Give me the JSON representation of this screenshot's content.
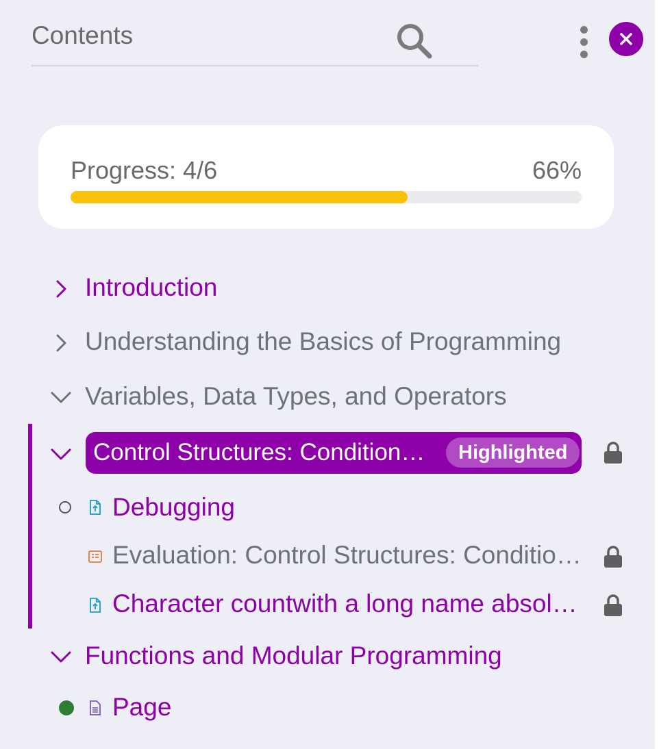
{
  "header": {
    "title": "Contents",
    "icons": [
      "search-icon",
      "more-vertical-icon",
      "close-icon"
    ]
  },
  "progress": {
    "label": "Progress: 4/6",
    "percent_text": "66%",
    "fraction": 0.66
  },
  "outline": {
    "intro": {
      "label": "Introduction",
      "state": "collapsed"
    },
    "basics": {
      "label": "Understanding the Basics of Programming",
      "state": "collapsed"
    },
    "variables": {
      "label": "Variables, Data Types, and Operators",
      "state": "expanded"
    },
    "control": {
      "label": "Control Structures: Conditionals and Loops",
      "badge": "Highlighted",
      "state": "expanded",
      "locked": true
    },
    "control_items": [
      {
        "label": "Debugging",
        "icon": "upload-file-icon",
        "status": "not-started"
      },
      {
        "label": "Evaluation: Control Structures: Conditionals and Loops",
        "icon": "quiz-icon",
        "locked": true
      },
      {
        "label": "Character countwith a long name absolutely",
        "icon": "upload-file-icon",
        "locked": true
      }
    ],
    "functions": {
      "label": "Functions and Modular Programming",
      "state": "expanded"
    },
    "functions_items": [
      {
        "label": "Page",
        "icon": "page-icon",
        "status": "completed"
      }
    ]
  },
  "colors": {
    "accent": "#8e00a8",
    "progress_fill": "#fbc10a",
    "completed": "#2f7d32",
    "panel_bg": "#eeeef7"
  }
}
